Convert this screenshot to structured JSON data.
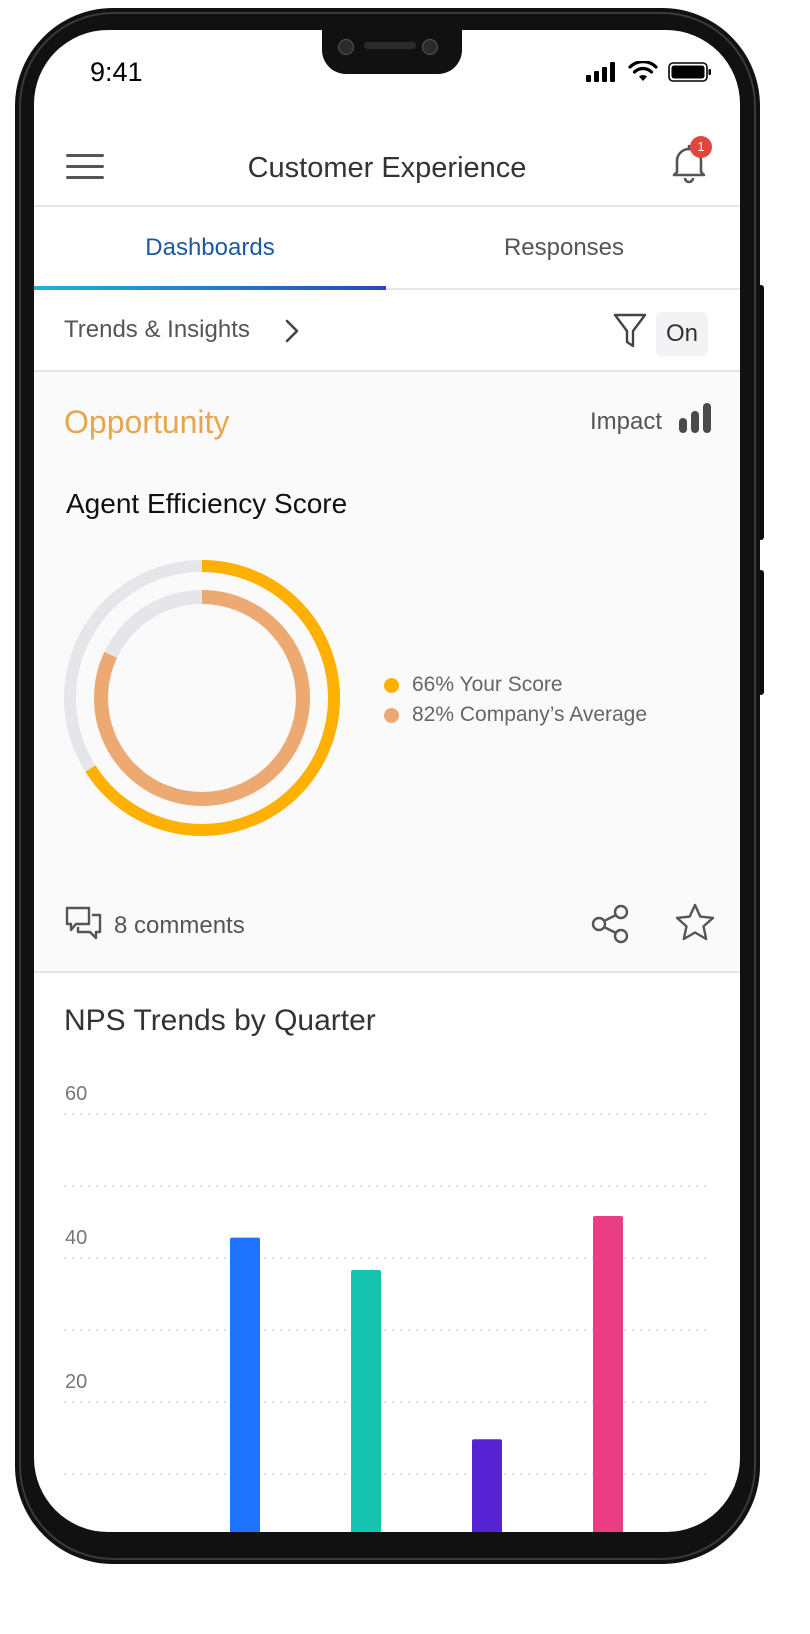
{
  "status_bar": {
    "time": "9:41",
    "signal_icon": "signal-icon",
    "wifi_icon": "wifi-icon",
    "battery_icon": "battery-icon"
  },
  "header": {
    "title": "Customer Experience",
    "menu_icon": "hamburger-menu-icon",
    "notifications_icon": "bell-icon",
    "notification_count": "1"
  },
  "tabs": [
    {
      "label": "Dashboards",
      "active": true
    },
    {
      "label": "Responses",
      "active": false
    }
  ],
  "trends": {
    "label": "Trends & Insights",
    "filter_icon": "filter-icon",
    "filter_state": "On"
  },
  "opportunity_card": {
    "category": "Opportunity",
    "impact_label": "Impact",
    "impact_icon": "bar-chart-icon",
    "metric_title": "Agent Efficiency Score",
    "legend": [
      {
        "label": "66% Your Score",
        "color": "#FFB000"
      },
      {
        "label": "82% Company’s Average",
        "color": "#ECAA72"
      }
    ],
    "comments_label": "8 comments",
    "comments_icon": "comments-icon",
    "share_icon": "share-icon",
    "favorite_icon": "star-icon"
  },
  "colors": {
    "accent": "#1C5AA0",
    "opportunity": "#E8A54F",
    "track": "#E6E6EA",
    "badge": "#E0463C"
  },
  "nps_chart": {
    "title": "NPS Trends by Quarter",
    "chart_data": {
      "type": "bar",
      "title": "NPS Trends by Quarter",
      "categories": [
        "",
        "",
        "",
        ""
      ],
      "values": [
        42,
        37.5,
        14,
        45
      ],
      "colors": [
        "#1E73FF",
        "#17C4AF",
        "#5523D4",
        "#EA3D83"
      ],
      "ytick_labels": [
        "60",
        "40",
        "20"
      ],
      "ylim": [
        0,
        60
      ],
      "grid": true
    }
  }
}
